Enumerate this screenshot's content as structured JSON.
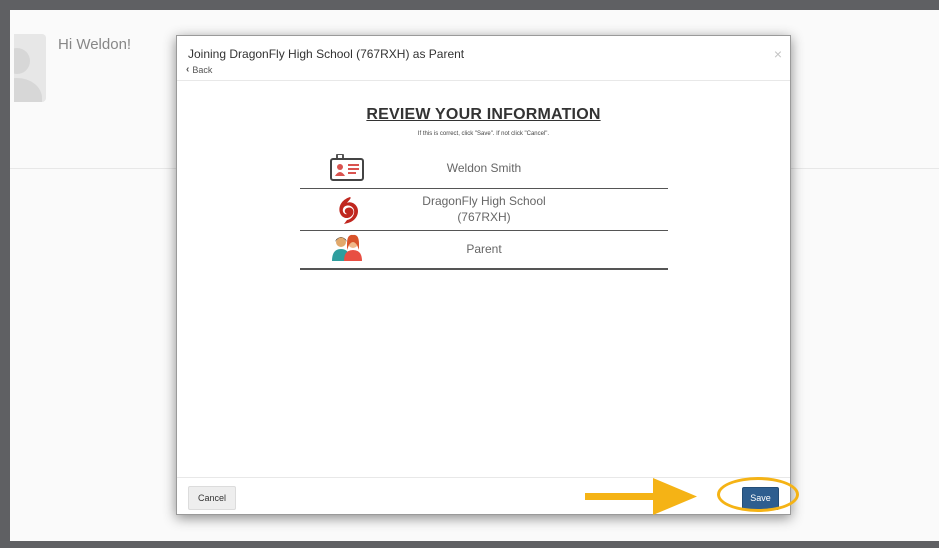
{
  "background": {
    "greeting": "Hi Weldon!"
  },
  "modal": {
    "title": "Joining DragonFly High School (767RXH) as Parent",
    "back_label": "Back",
    "close_glyph": "×",
    "heading": "REVIEW YOUR INFORMATION",
    "subheading": "If this is correct, click \"Save\". If not click \"Cancel\".",
    "rows": [
      {
        "icon": "id-badge-icon",
        "lines": [
          "Weldon Smith"
        ]
      },
      {
        "icon": "dragonfly-logo-icon",
        "lines": [
          "DragonFly High School",
          "(767RXH)"
        ]
      },
      {
        "icon": "parent-avatar-icon",
        "lines": [
          "Parent"
        ]
      }
    ],
    "cancel_label": "Cancel",
    "save_label": "Save"
  },
  "colors": {
    "save_button": "#2e5e8f",
    "annotation": "#f5b315",
    "frame": "#5f6063"
  }
}
